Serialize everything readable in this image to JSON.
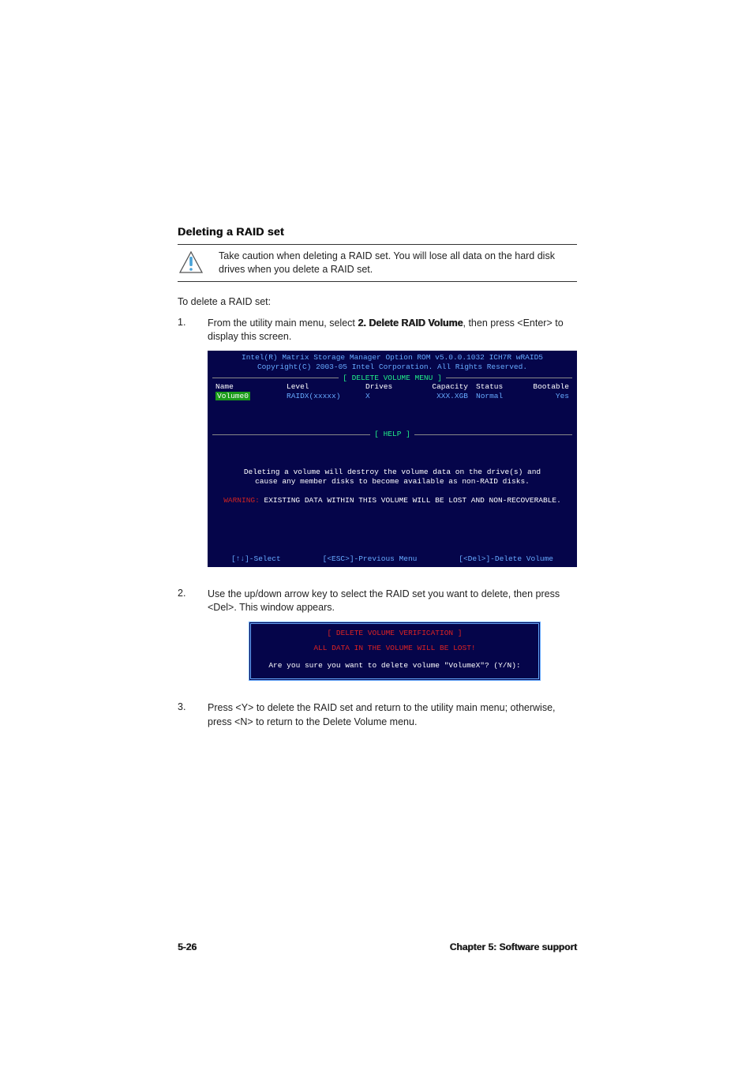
{
  "heading": "Deleting a RAID set",
  "caution": {
    "text": "Take caution when deleting a RAID set. You will lose all data on the hard disk drives when you delete a RAID set."
  },
  "intro": "To delete a RAID set:",
  "steps": {
    "s1": {
      "num": "1.",
      "prefix": "From the utility main menu, select ",
      "bold": "2. Delete RAID Volume",
      "suffix": ", then press <Enter> to display this screen."
    },
    "s2": {
      "num": "2.",
      "text": "Use the up/down arrow key to select the RAID set you want to delete, then press <Del>. This window appears."
    },
    "s3": {
      "num": "3.",
      "text": "Press <Y> to delete the RAID set and return to the utility main menu; otherwise, press <N> to return to the Delete Volume menu."
    }
  },
  "panel": {
    "title1": "Intel(R) Matrix Storage Manager Option ROM v5.0.0.1032 ICH7R wRAID5",
    "title2": "Copyright(C) 2003-05 Intel Corporation. All Rights Reserved.",
    "menu_label": "[ DELETE VOLUME MENU ]",
    "help_label": "[ HELP ]",
    "headers": {
      "name": "Name",
      "level": "Level",
      "drives": "Drives",
      "capacity": "Capacity",
      "status": "Status",
      "bootable": "Bootable"
    },
    "row": {
      "name": "Volume0",
      "level": "RAIDX(xxxxx)",
      "drives": "X",
      "capacity": "XXX.XGB",
      "status": "Normal",
      "bootable": "Yes"
    },
    "help_line1": "Deleting a volume will destroy the volume data on the drive(s) and",
    "help_line2": "cause any member disks to become available as non-RAID disks.",
    "warn_label": "WARNING:",
    "warn_text": " EXISTING DATA WITHIN THIS VOLUME WILL BE LOST AND NON-RECOVERABLE.",
    "keys": {
      "select": "[↑↓]-Select",
      "prev": "[<ESC>]-Previous Menu",
      "del": "[<Del>]-Delete Volume"
    }
  },
  "verif": {
    "title": "[ DELETE VOLUME VERIFICATION ]",
    "line1": "ALL DATA IN THE VOLUME WILL BE LOST!",
    "line2": "Are you sure you want to delete volume \"VolumeX\"? (Y/N):"
  },
  "footer": {
    "pagenum": "5-26",
    "chapter": "Chapter 5: Software support"
  }
}
